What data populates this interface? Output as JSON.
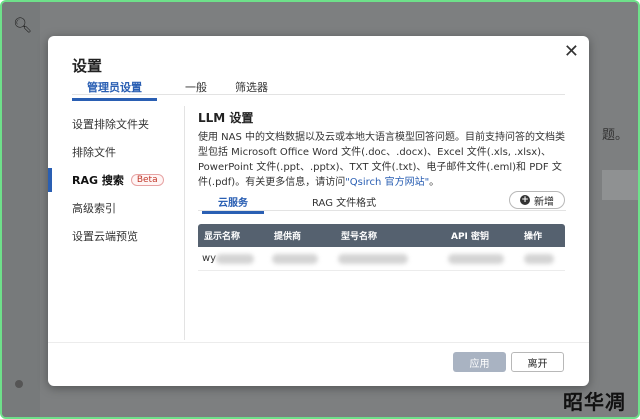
{
  "background": {
    "search_icon": "search-icon",
    "partial_text": "题。",
    "watermark": "昭华凋"
  },
  "dialog": {
    "title": "设置",
    "close_icon": "close-icon",
    "tabs": [
      {
        "label": "管理员设置",
        "active": true
      },
      {
        "label": "一般",
        "active": false
      },
      {
        "label": "筛选器",
        "active": false
      }
    ],
    "sidebar": {
      "items": [
        {
          "label": "设置排除文件夹"
        },
        {
          "label": "排除文件"
        },
        {
          "label": "RAG 搜索",
          "badge": "Beta",
          "active": true
        },
        {
          "label": "高级索引"
        },
        {
          "label": "设置云端预览"
        }
      ]
    },
    "section": {
      "title": "LLM 设置",
      "description_pre": "使用 NAS 中的文档数据以及云或本地大语言模型回答问题。目前支持问答的文档类型包括 Microsoft Office Word 文件(.doc、.docx)、Excel 文件(.xls, .xlsx)、PowerPoint 文件(.ppt、.pptx)、TXT 文件(.txt)、电子邮件文件(.eml)和 PDF 文件(.pdf)。有关更多信息，请访问",
      "link_text": "\"Qsirch 官方网站\"",
      "description_post": "。"
    },
    "sub_tabs": [
      {
        "label": "云服务",
        "active": true
      },
      {
        "label": "RAG 文件格式",
        "active": false
      }
    ],
    "add_button": {
      "label": "新增",
      "icon": "plus-circle-icon"
    },
    "table": {
      "columns": [
        "显示名称",
        "提供商",
        "型号名称",
        "API 密钥",
        "操作"
      ],
      "rows": [
        {
          "display_name": "wy"
        }
      ]
    },
    "buttons": {
      "apply": "应用",
      "leave": "离开"
    },
    "colors": {
      "accent": "#2a5fb3",
      "table_header": "#55616f",
      "apply_disabled": "#a9b3c2",
      "frame_border": "#6ee08a"
    }
  }
}
